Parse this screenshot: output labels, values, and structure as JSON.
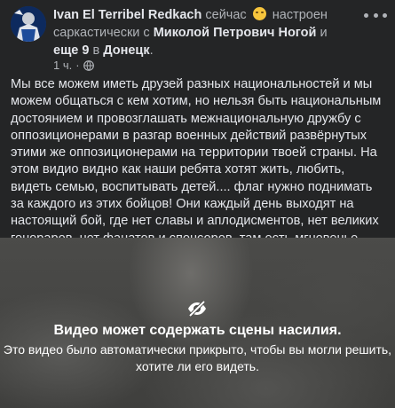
{
  "post": {
    "author": "Ivan El Terribel Redkach",
    "time_label": "сейчас",
    "feeling": "настроен саркастически с",
    "tagged_person": "Миколой Петрович Ногой",
    "and_label": "и",
    "others": "еще 9",
    "in_label": "в",
    "location": "Донецк",
    "location_suffix": ".",
    "age": "1 ч.",
    "dot": "·",
    "text": "Мы все можем иметь друзей разных национальностей и мы можем общаться с кем хотим, но нельзя быть национальным достоянием и провозглашать межнациональную дружбу с оппозиционерами в разгар военных действий развёрнутых этими же оппозиционерами на территории твоей страны. На этом видио видно как наши ребята хотят жить, любить, видеть семью, воспитывать детей.... флаг нужно поднимать за каждого из этих бойцов! Они каждый день выходят на настоящий бой, где нет славы и аплодисментов, нет великих гонораров, нет фанатов и спонсоров, там есть мгновенье между жизнью и смертью...."
  },
  "video": {
    "warning_title": "Видео может содержать сцены насилия.",
    "warning_line1": "Это видео было автоматически прикрыто, чтобы вы могли решить,",
    "warning_line2": "хотите ли его видеть.",
    "icon": "eye-slash-icon"
  },
  "icons": [
    "avatar",
    "smiley-emoji-icon",
    "globe-icon",
    "more-icon",
    "eye-slash-icon"
  ],
  "colors": {
    "background": "#242526",
    "primary_text": "#e4e6eb",
    "secondary_text": "#b0b3b8",
    "emoji": "#f7c53c"
  }
}
